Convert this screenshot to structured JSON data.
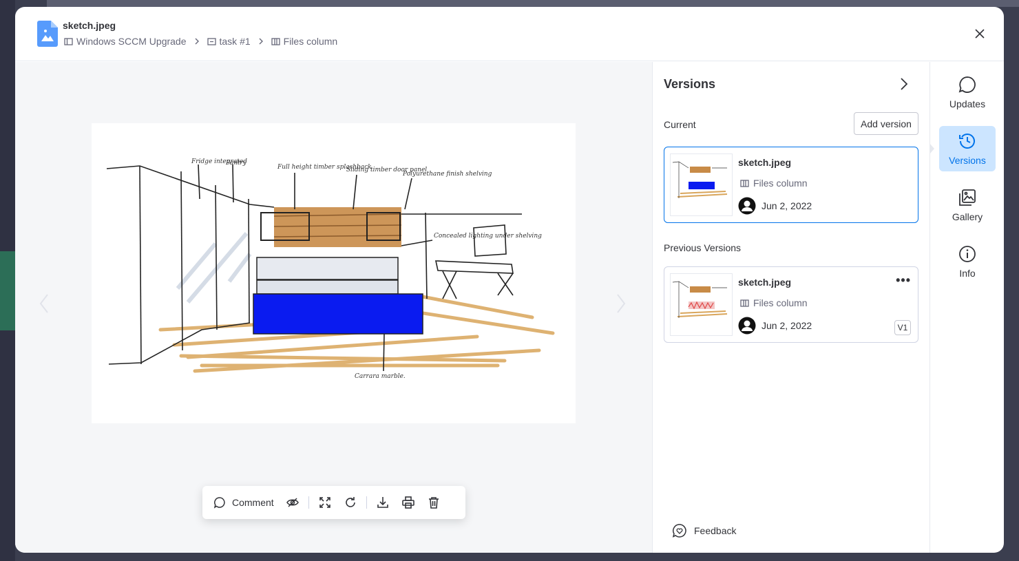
{
  "header": {
    "file_name": "sketch.jpeg",
    "breadcrumbs": [
      {
        "label": "Windows SCCM Upgrade",
        "icon": "board-icon"
      },
      {
        "label": "task #1",
        "icon": "item-icon"
      },
      {
        "label": "Files column",
        "icon": "column-icon"
      }
    ]
  },
  "image": {
    "annotations": [
      "Fridge integrated",
      "Pantry",
      "Full height timber splashback",
      "Sliding timber door panel",
      "Polyurethane finish shelving",
      "Concealed lighting under shelving",
      "Carrara marble."
    ]
  },
  "toolbar": {
    "comment_label": "Comment",
    "icons": [
      "eye-hidden-icon",
      "fullscreen-icon",
      "rotate-icon",
      "download-icon",
      "print-icon",
      "trash-icon"
    ]
  },
  "versions_panel": {
    "title": "Versions",
    "current_label": "Current",
    "add_version_label": "Add version",
    "current": {
      "name": "sketch.jpeg",
      "column": "Files column",
      "date": "Jun 2, 2022"
    },
    "previous_label": "Previous Versions",
    "previous": [
      {
        "name": "sketch.jpeg",
        "column": "Files column",
        "date": "Jun 2, 2022",
        "badge": "V1"
      }
    ],
    "feedback_label": "Feedback"
  },
  "rail": {
    "items": [
      {
        "label": "Updates",
        "icon": "chat-icon",
        "active": false
      },
      {
        "label": "Versions",
        "icon": "history-icon",
        "active": true
      },
      {
        "label": "Gallery",
        "icon": "gallery-icon",
        "active": false
      },
      {
        "label": "Info",
        "icon": "info-icon",
        "active": false
      }
    ]
  },
  "colors": {
    "accent": "#0073ea",
    "active_bg": "#cce5ff",
    "highlight_blue": "#0a1bf0",
    "file_icon": "#579bfc"
  }
}
